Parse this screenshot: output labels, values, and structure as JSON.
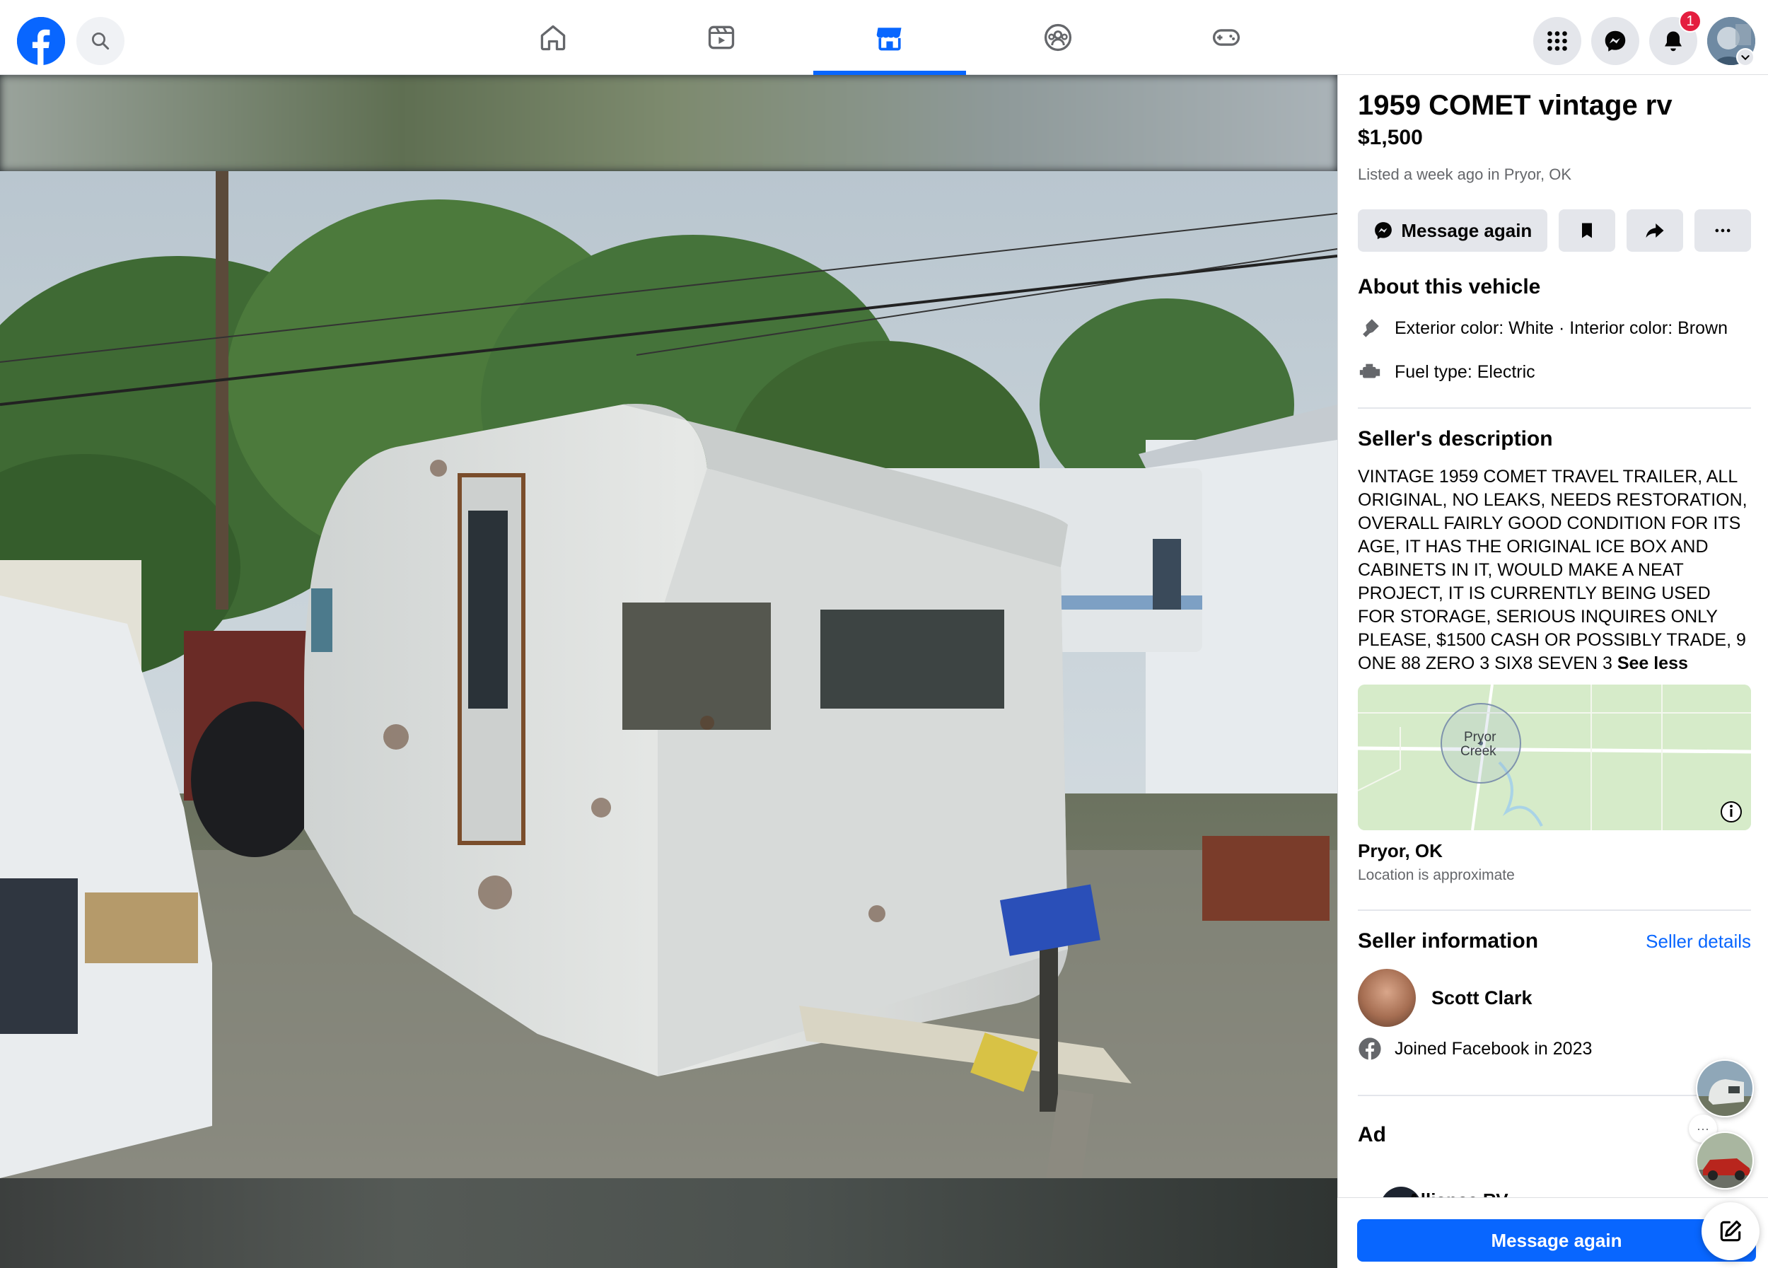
{
  "colors": {
    "brand": "#0866ff",
    "notification": "#e41e3f",
    "button_grey": "#e4e6eb",
    "muted_text": "#65676b"
  },
  "nav": {
    "tabs": [
      {
        "icon": "home-icon"
      },
      {
        "icon": "video-icon"
      },
      {
        "icon": "marketplace-icon",
        "active": true
      },
      {
        "icon": "groups-icon"
      },
      {
        "icon": "gaming-icon"
      }
    ],
    "notification_count": "1"
  },
  "listing": {
    "title": "1959 COMET vintage rv",
    "price": "$1,500",
    "listed": "Listed a week ago in Pryor, OK",
    "message_again": "Message again"
  },
  "about": {
    "heading": "About this vehicle",
    "colors_line": "Exterior color: White · Interior color: Brown",
    "fuel_line": "Fuel type: Electric"
  },
  "seller_description": {
    "heading": "Seller's description",
    "text": "VINTAGE 1959 COMET TRAVEL TRAILER, ALL ORIGINAL, NO LEAKS, NEEDS RESTORATION, OVERALL FAIRLY   GOOD CONDITION FOR ITS AGE, IT HAS THE ORIGINAL ICE BOX AND CABINETS IN IT, WOULD MAKE A NEAT PROJECT, IT IS CURRENTLY BEING USED FOR STORAGE, SERIOUS INQUIRES ONLY PLEASE, $1500 CASH OR POSSIBLY TRADE, 9 ONE  88 ZERO  3 SIX8 SEVEN  3 ",
    "see_less": "See less"
  },
  "map": {
    "label_line1": "Pryor",
    "label_line2": "Creek"
  },
  "location": {
    "name": "Pryor, OK",
    "note": "Location is approximate"
  },
  "seller": {
    "heading": "Seller information",
    "details_link": "Seller details",
    "name": "Scott Clark",
    "joined": "Joined Facebook in 2023"
  },
  "ad": {
    "heading": "Ad",
    "advertiser": "Alliance RV"
  },
  "bottom": {
    "message_again": "Message again"
  }
}
